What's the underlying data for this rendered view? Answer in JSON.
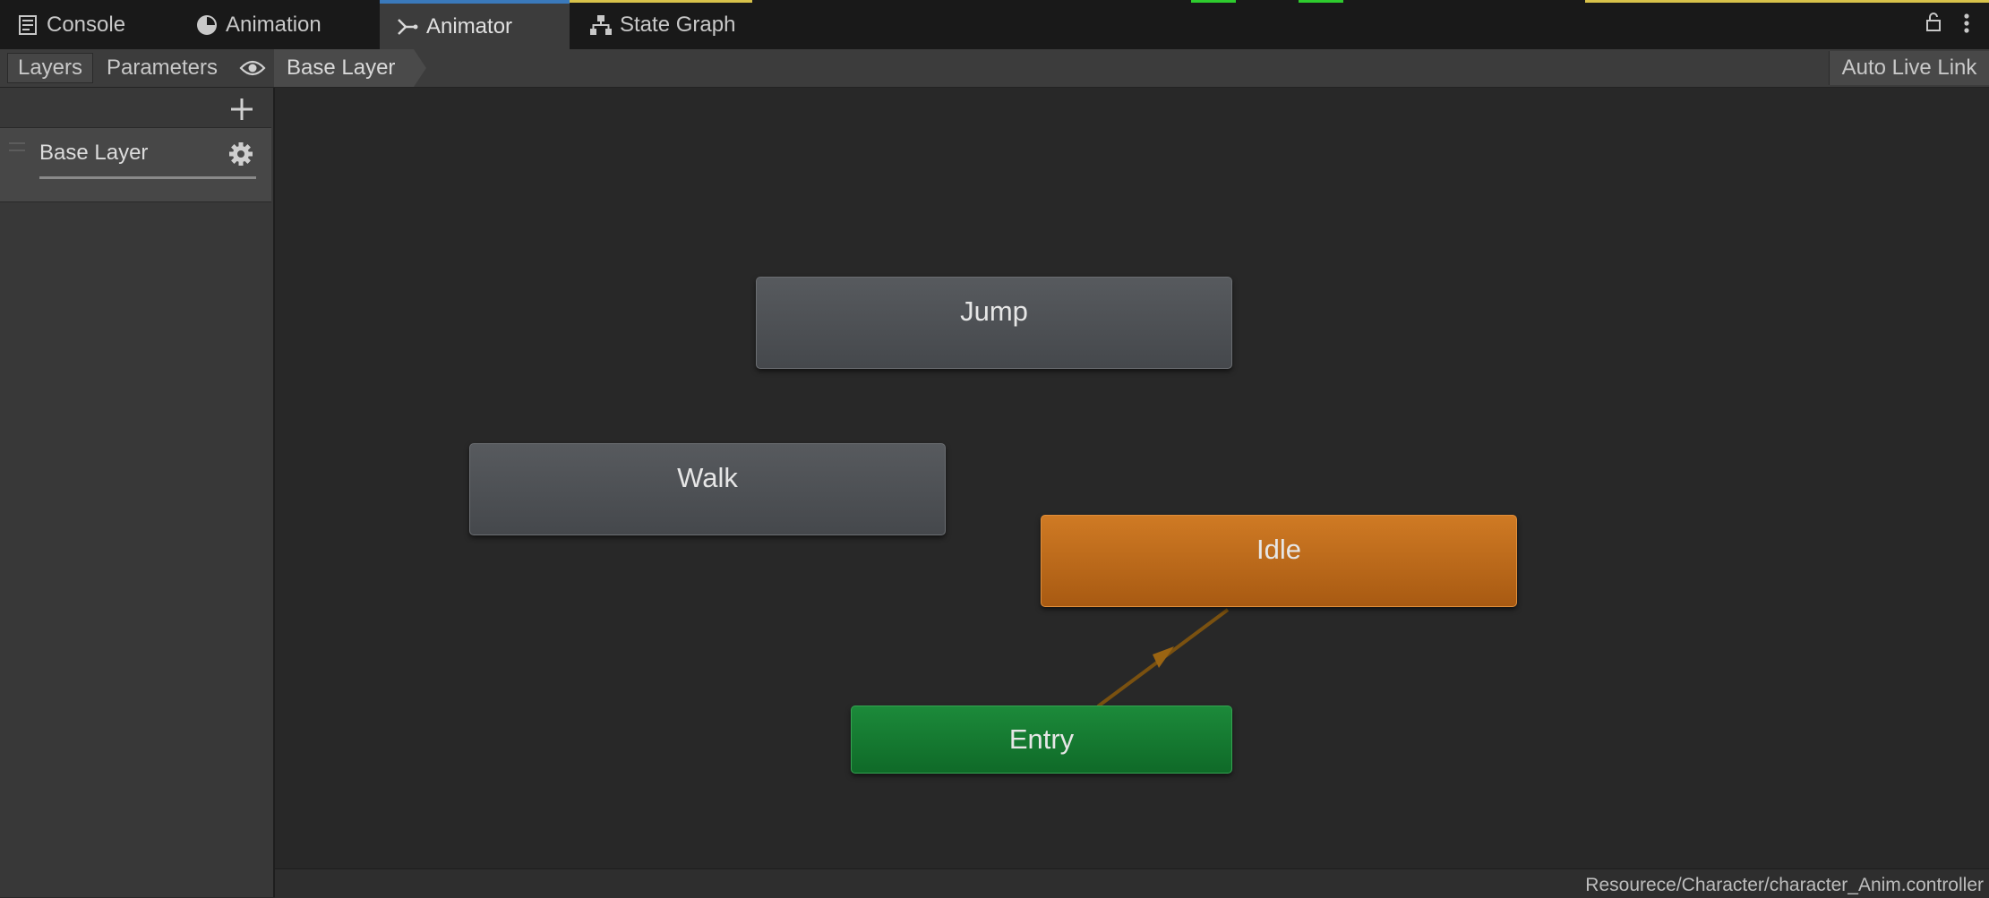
{
  "tabs": [
    {
      "label": "Console",
      "icon": "console-icon"
    },
    {
      "label": "Animation",
      "icon": "clock-icon"
    },
    {
      "label": "Animator",
      "icon": "animator-icon"
    },
    {
      "label": "State Graph",
      "icon": "hierarchy-icon"
    }
  ],
  "active_tab": "Animator",
  "toolbar": {
    "layers_label": "Layers",
    "parameters_label": "Parameters",
    "breadcrumb": "Base Layer",
    "auto_live_link_label": "Auto Live Link"
  },
  "layers": [
    {
      "name": "Base Layer",
      "weight": 1.0
    }
  ],
  "graph": {
    "states": [
      {
        "name": "Jump",
        "kind": "state"
      },
      {
        "name": "Walk",
        "kind": "state"
      },
      {
        "name": "Idle",
        "kind": "default-state"
      },
      {
        "name": "Entry",
        "kind": "entry"
      }
    ],
    "transitions": [
      {
        "from": "Entry",
        "to": "Idle"
      }
    ]
  },
  "status": {
    "asset_path": "Resourece/Character/character_Anim.controller"
  },
  "colors": {
    "active_tab_accent": "#3a79bb",
    "default_state": "#c06f1e",
    "entry_state": "#178032",
    "state": "#4e5155",
    "transition": "#8a5a10"
  }
}
